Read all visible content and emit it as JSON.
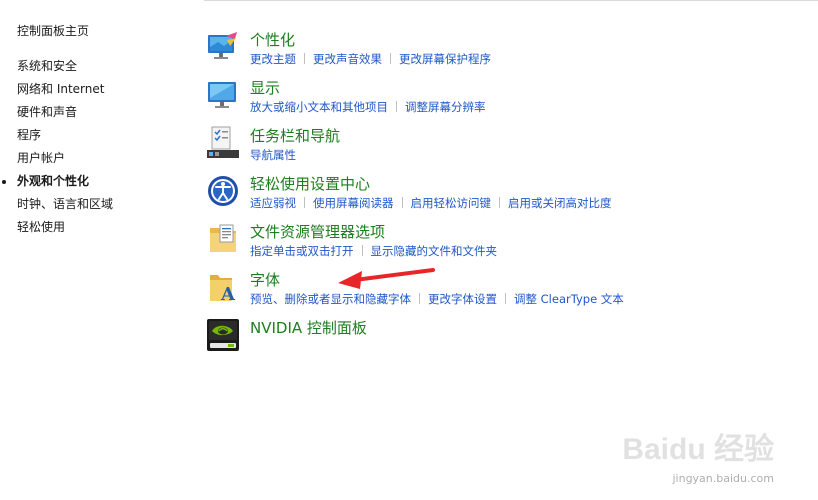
{
  "nav": {
    "home": "控制面板主页",
    "items": [
      {
        "label": "系统和安全"
      },
      {
        "label": "网络和 Internet"
      },
      {
        "label": "硬件和声音"
      },
      {
        "label": "程序"
      },
      {
        "label": "用户帐户"
      },
      {
        "label": "外观和个性化",
        "active": true
      },
      {
        "label": "时钟、语言和区域"
      },
      {
        "label": "轻松使用"
      }
    ]
  },
  "categories": [
    {
      "title": "个性化",
      "icon": "personalization-icon",
      "links": [
        "更改主题",
        "更改声音效果",
        "更改屏幕保护程序"
      ]
    },
    {
      "title": "显示",
      "icon": "display-icon",
      "links": [
        "放大或缩小文本和其他项目",
        "调整屏幕分辨率"
      ]
    },
    {
      "title": "任务栏和导航",
      "icon": "taskbar-icon",
      "links": [
        "导航属性"
      ]
    },
    {
      "title": "轻松使用设置中心",
      "icon": "ease-of-access-icon",
      "links": [
        "适应弱视",
        "使用屏幕阅读器",
        "启用轻松访问键",
        "启用或关闭高对比度"
      ]
    },
    {
      "title": "文件资源管理器选项",
      "icon": "folder-options-icon",
      "links": [
        "指定单击或双击打开",
        "显示隐藏的文件和文件夹"
      ]
    },
    {
      "title": "字体",
      "icon": "fonts-icon",
      "links": [
        "预览、删除或者显示和隐藏字体",
        "更改字体设置",
        "调整 ClearType 文本"
      ]
    },
    {
      "title": "NVIDIA 控制面板",
      "icon": "nvidia-icon",
      "links": []
    }
  ],
  "watermark": {
    "mark": "Baidu 经验",
    "url": "jingyan.baidu.com"
  },
  "colors": {
    "title": "#1e7d1e",
    "link": "#1f58c8",
    "arrow": "#e8262a"
  }
}
